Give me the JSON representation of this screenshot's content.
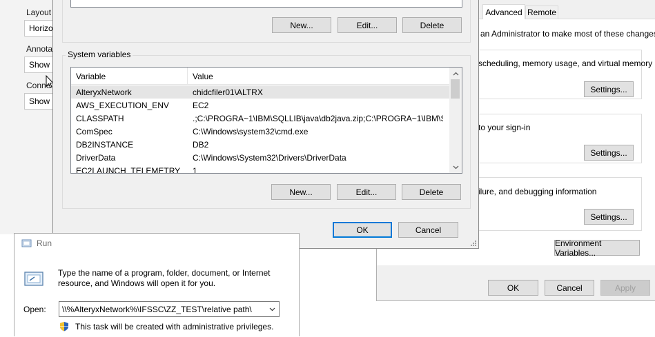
{
  "background_app": {
    "labels": [
      {
        "label": "Layout",
        "value": "Horizo"
      },
      {
        "label": "Annota",
        "value": "Show"
      },
      {
        "label": "Conne",
        "value": "Show C"
      }
    ]
  },
  "system_properties": {
    "tabs": [
      {
        "label": "Advanced",
        "active": true
      },
      {
        "label": "Remote",
        "active": false
      }
    ],
    "admin_note": "an Administrator to make most of these changes.",
    "performance_text": "scheduling, memory usage, and virtual memory",
    "profiles_text": "to your sign-in",
    "startup_text": "ilure, and debugging information",
    "settings_label": "Settings...",
    "env_button": "Environment Variables...",
    "ok": "OK",
    "cancel": "Cancel",
    "apply": "Apply"
  },
  "env_dialog": {
    "user_buttons": {
      "new": "New...",
      "edit": "Edit...",
      "delete": "Delete"
    },
    "system_legend": "System variables",
    "columns": {
      "variable": "Variable",
      "value": "Value"
    },
    "rows": [
      {
        "variable": "AlteryxNetwork",
        "value": "chidcfiler01\\ALTRX",
        "selected": true
      },
      {
        "variable": "AWS_EXECUTION_ENV",
        "value": "EC2",
        "selected": false
      },
      {
        "variable": "CLASSPATH",
        "value": ".;C:\\PROGRA~1\\IBM\\SQLLIB\\java\\db2java.zip;C:\\PROGRA~1\\IBM\\S...",
        "selected": false
      },
      {
        "variable": "ComSpec",
        "value": "C:\\Windows\\system32\\cmd.exe",
        "selected": false
      },
      {
        "variable": "DB2INSTANCE",
        "value": "DB2",
        "selected": false
      },
      {
        "variable": "DriverData",
        "value": "C:\\Windows\\System32\\Drivers\\DriverData",
        "selected": false
      },
      {
        "variable": "EC2LAUNCH_TELEMETRY",
        "value": "1",
        "selected": false
      }
    ],
    "system_buttons": {
      "new": "New...",
      "edit": "Edit...",
      "delete": "Delete"
    },
    "ok": "OK",
    "cancel": "Cancel"
  },
  "run_dialog": {
    "title": "Run",
    "description": "Type the name of a program, folder, document, or Internet resource, and Windows will open it for you.",
    "open_label": "Open:",
    "open_value": "\\\\%AlteryxNetwork%\\IFSSC\\ZZ_TEST\\relative path\\",
    "admin_note": "This task will be created with administrative privileges."
  },
  "colors": {
    "accent": "#0078d7",
    "dialog_bg": "#f0f0f0",
    "selected_row": "#e5e5e5"
  }
}
